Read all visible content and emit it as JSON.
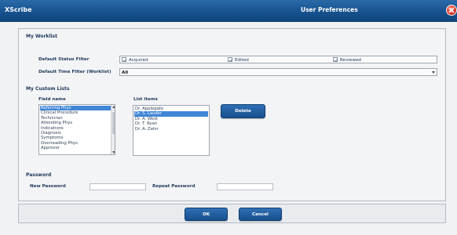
{
  "window": {
    "app_name": "XScribe",
    "title": "User Preferences"
  },
  "my_worklist": {
    "section_title": "My Worklist",
    "status_filter_label": "Default Status Filter",
    "status_options": [
      {
        "label": "Acquired",
        "checked": true
      },
      {
        "label": "Edited",
        "checked": true
      },
      {
        "label": "Reviewed",
        "checked": true
      }
    ],
    "time_filter_label": "Default Time Filter (Worklist)",
    "time_filter_value": "All"
  },
  "custom_lists": {
    "section_title": "My Custom Lists",
    "field_name_header": "Field name",
    "list_items_header": "List items",
    "field_names": [
      "Referring Phys",
      "Clinical Procedure",
      "Technician",
      "Attending Phys",
      "Indications",
      "Diagnosis",
      "Symptoms",
      "Overreading Phys",
      "Approver"
    ],
    "selected_field_index": 0,
    "list_items": [
      "Dr. Applegate",
      "Dr. S. Lauder",
      "Dr. A. West",
      "Dr. T. Ryan",
      "Dr. A. Zahn"
    ],
    "selected_list_index": 1,
    "delete_label": "Delete"
  },
  "password": {
    "section_title": "Password",
    "new_label": "New Password",
    "repeat_label": "Repeat Password",
    "new_value": "",
    "repeat_value": ""
  },
  "footer": {
    "ok_label": "OK",
    "cancel_label": "Cancel"
  },
  "colors": {
    "titlebar": "#17528f",
    "accent_button": "#1d5a99",
    "selection": "#3f86d6",
    "close": "#d63324"
  },
  "icons": {
    "close": "close-icon",
    "checkbox_check": "check-icon",
    "dropdown": "chevron-down-icon"
  }
}
